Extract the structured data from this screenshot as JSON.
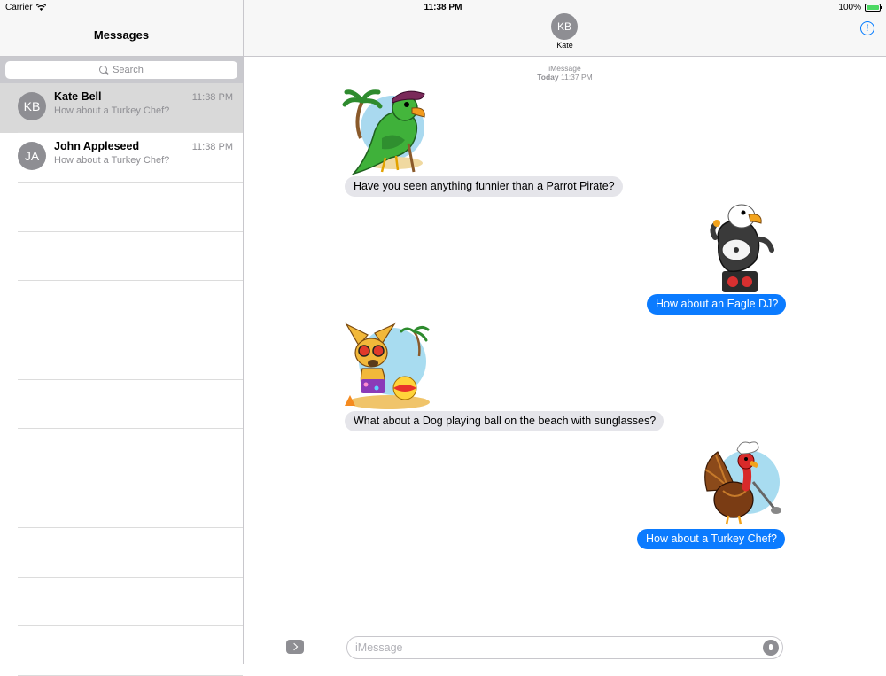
{
  "status_bar": {
    "carrier": "Carrier",
    "time": "11:38 PM",
    "battery": "100%",
    "battery_level": 1.0
  },
  "sidebar": {
    "title": "Messages",
    "search_placeholder": "Search",
    "conversations": [
      {
        "initials": "KB",
        "name": "Kate Bell",
        "time": "11:38 PM",
        "preview": "How about a Turkey Chef?",
        "selected": true
      },
      {
        "initials": "JA",
        "name": "John Appleseed",
        "time": "11:38 PM",
        "preview": "How about a Turkey Chef?",
        "selected": false
      }
    ]
  },
  "chat": {
    "contact_initials": "KB",
    "contact_name": "Kate",
    "service": "iMessage",
    "timestamp_day": "Today",
    "timestamp_time": "11:37 PM",
    "messages": [
      {
        "direction": "incoming",
        "sticker": "parrot-pirate",
        "text": "Have you seen anything funnier than a Parrot Pirate?"
      },
      {
        "direction": "outgoing",
        "sticker": "eagle-dj",
        "text": "How about an Eagle DJ?"
      },
      {
        "direction": "incoming",
        "sticker": "dog-beach",
        "text": "What about a Dog playing ball on the beach with sunglasses?"
      },
      {
        "direction": "outgoing",
        "sticker": "turkey-chef",
        "text": "How about a Turkey Chef?"
      }
    ],
    "input_placeholder": "iMessage"
  },
  "colors": {
    "accent": "#007aff",
    "outgoing_bubble": "#0b7bff",
    "incoming_bubble": "#e5e5ea",
    "selected_row": "#d9d9d9"
  }
}
